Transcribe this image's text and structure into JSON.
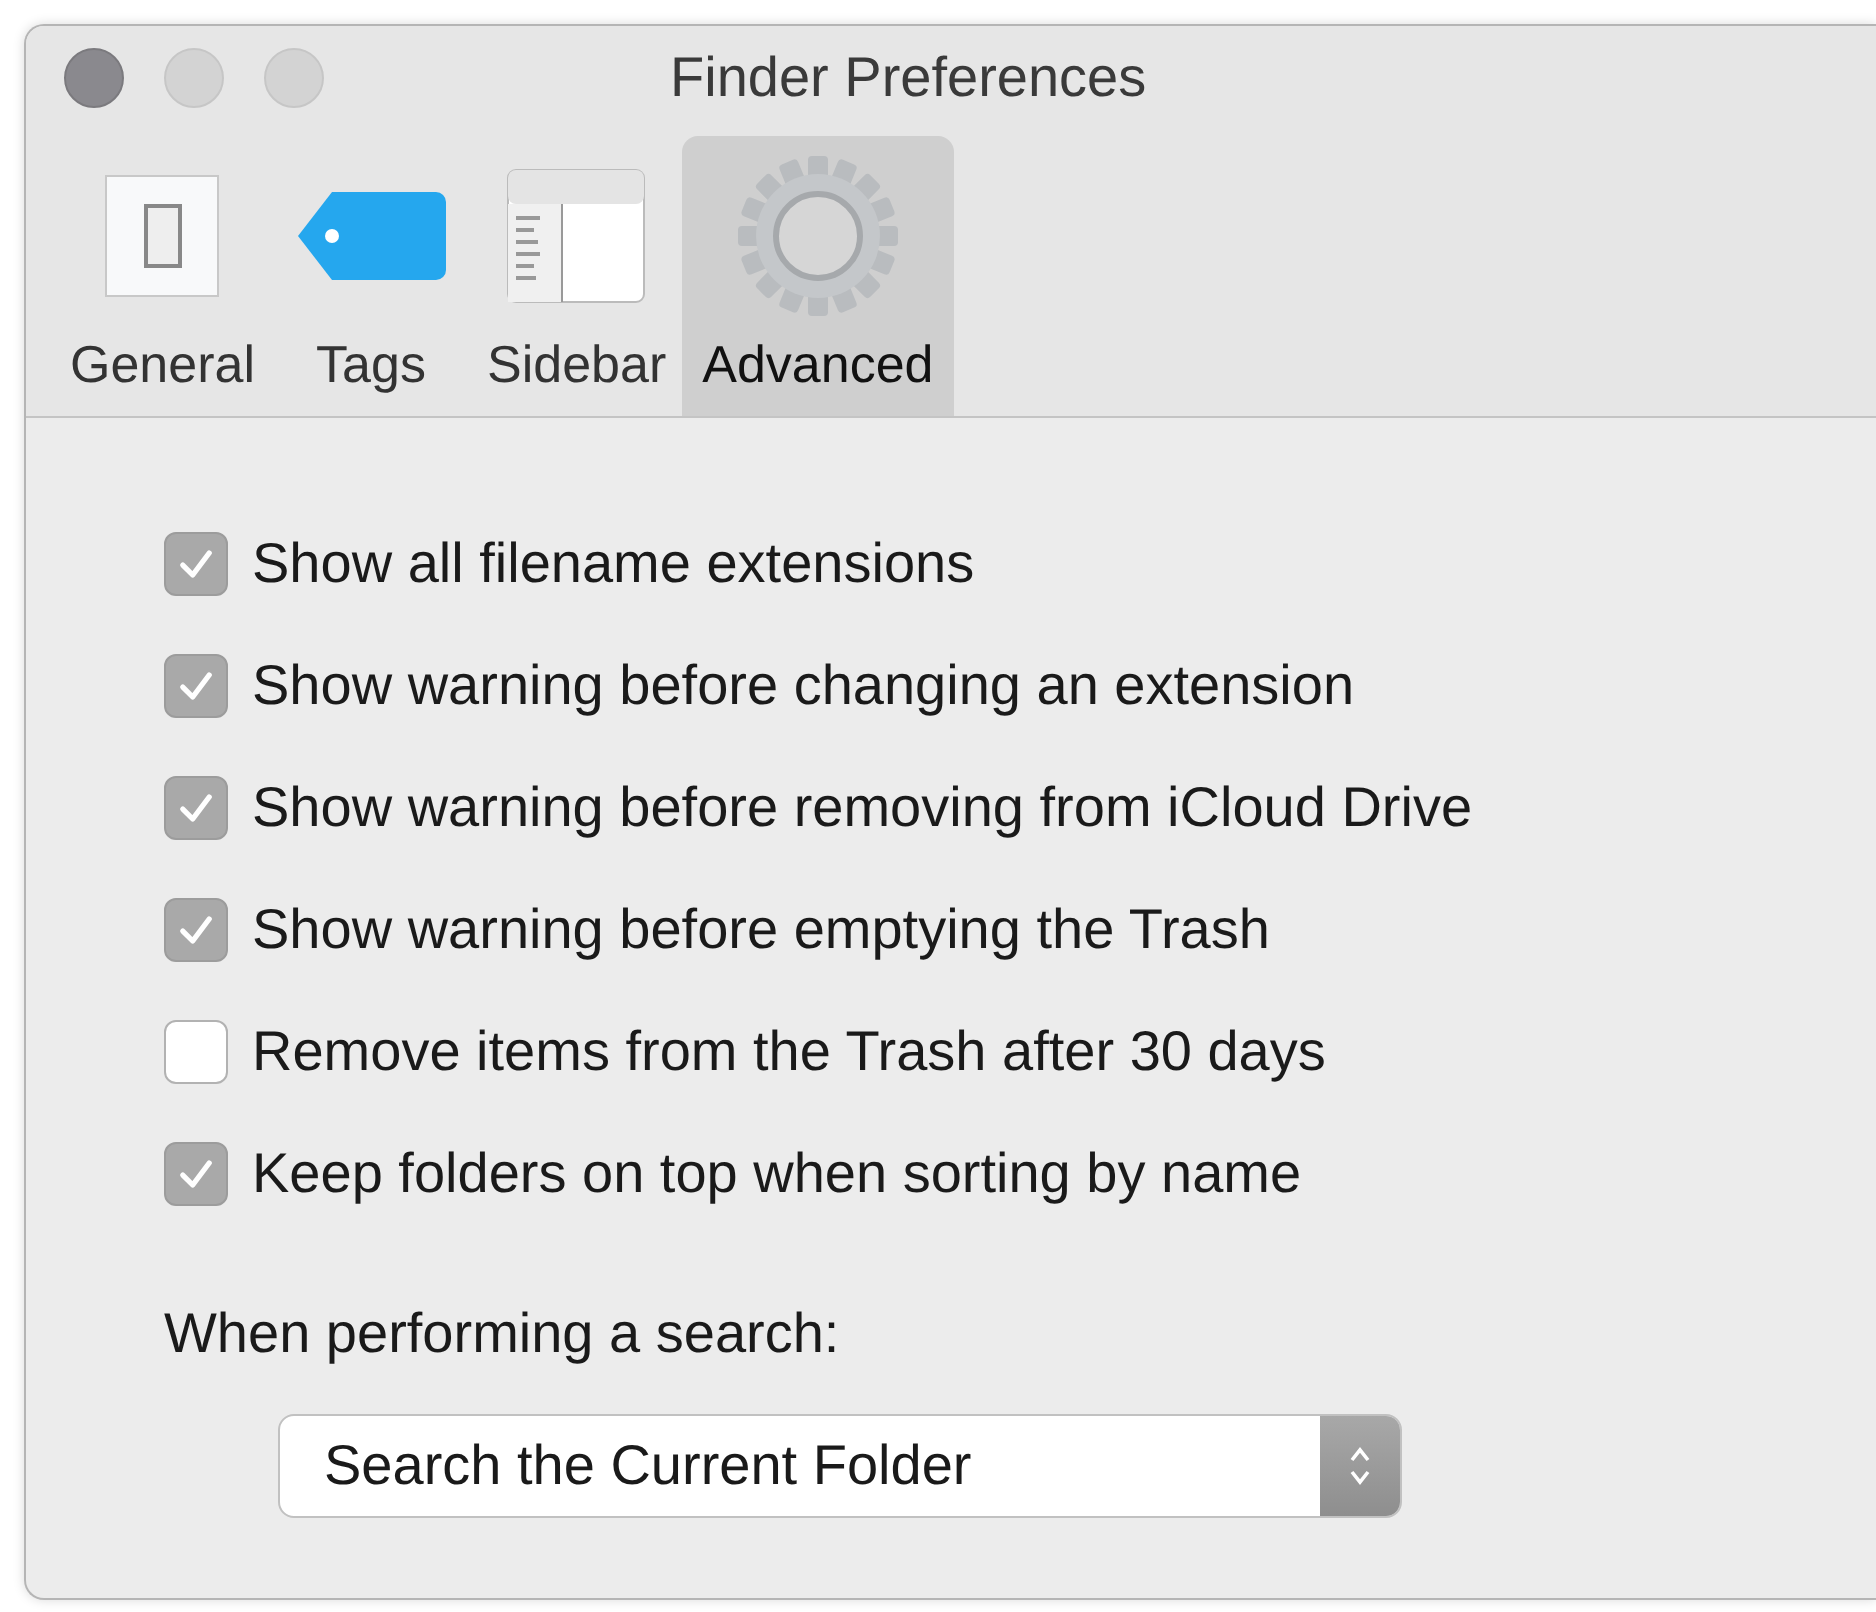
{
  "window": {
    "title": "Finder Preferences"
  },
  "tabs": [
    {
      "label": "General",
      "selected": false
    },
    {
      "label": "Tags",
      "selected": false
    },
    {
      "label": "Sidebar",
      "selected": false
    },
    {
      "label": "Advanced",
      "selected": true
    }
  ],
  "options": [
    {
      "label": "Show all filename extensions",
      "checked": true
    },
    {
      "label": "Show warning before changing an extension",
      "checked": true
    },
    {
      "label": "Show warning before removing from iCloud Drive",
      "checked": true
    },
    {
      "label": "Show warning before emptying the Trash",
      "checked": true
    },
    {
      "label": "Remove items from the Trash after 30 days",
      "checked": false
    },
    {
      "label": "Keep folders on top when sorting by name",
      "checked": true
    }
  ],
  "search": {
    "label": "When performing a search:",
    "value": "Search the Current Folder"
  }
}
